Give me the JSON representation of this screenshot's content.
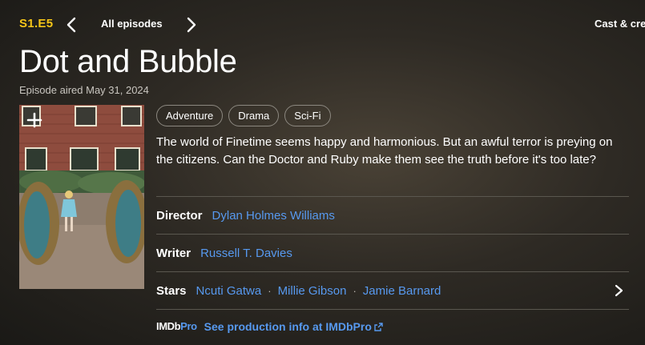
{
  "header": {
    "episode_code": "S1.E5",
    "all_episodes_label": "All episodes",
    "cast_crew_label": "Cast & crew",
    "prev_icon": "chevron-left-icon",
    "next_icon": "chevron-right-icon"
  },
  "episode": {
    "title": "Dot and Bubble",
    "aired": "Episode aired May 31, 2024",
    "genres": [
      "Adventure",
      "Drama",
      "Sci-Fi"
    ],
    "plot": "The world of Finetime seems happy and harmonious. But an awful terror is preying on the citizens. Can the Doctor and Ruby make them see the truth before it's too late?"
  },
  "poster": {
    "add_icon": "plus-icon"
  },
  "credits": {
    "director_label": "Director",
    "directors": [
      "Dylan Holmes Williams"
    ],
    "writer_label": "Writer",
    "writers": [
      "Russell T. Davies"
    ],
    "stars_label": "Stars",
    "stars": [
      "Ncuti Gatwa",
      "Millie Gibson",
      "Jamie Barnard"
    ],
    "separator": "·"
  },
  "imdbpro": {
    "logo_imdb": "IMDb",
    "logo_pro": "Pro",
    "link_label": "See production info at IMDbPro",
    "external_icon": "external-link-icon"
  },
  "colors": {
    "accent_yellow": "#f5c518",
    "link_blue": "#5799ef"
  }
}
